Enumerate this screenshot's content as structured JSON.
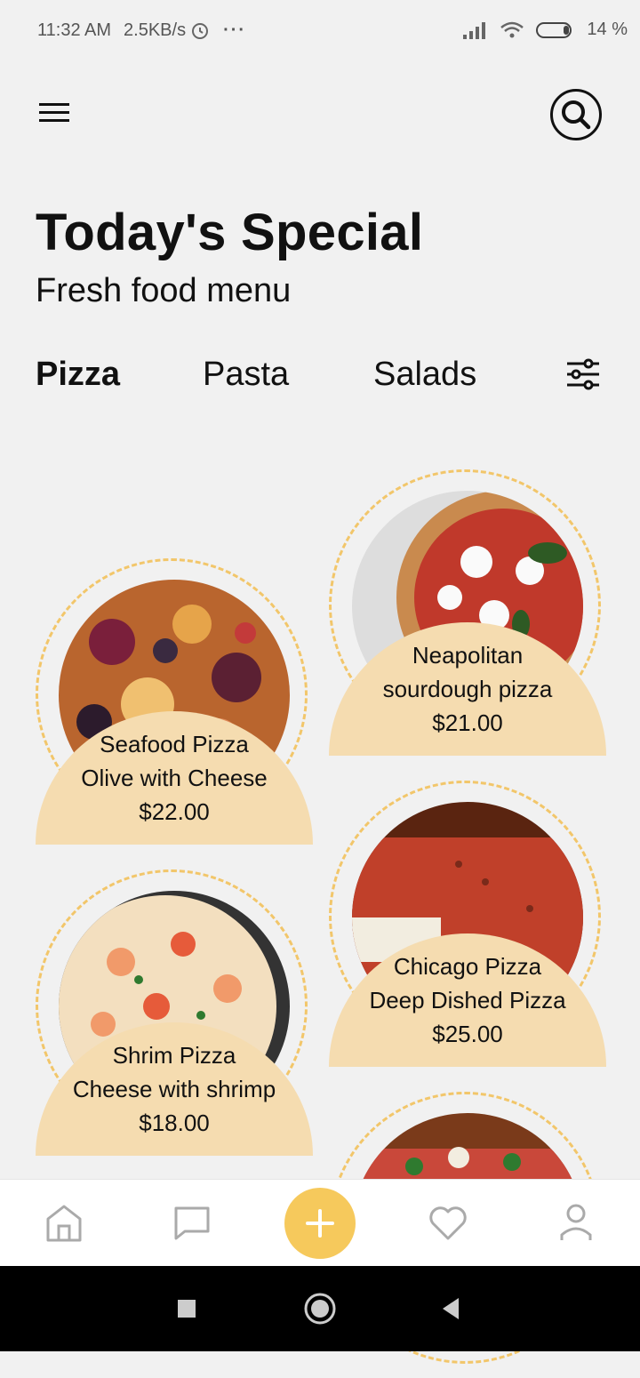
{
  "status": {
    "time": "11:32 AM",
    "speed": "2.5KB/s",
    "dots": "···",
    "battery": "14 %"
  },
  "header": {
    "title": "Today's Special",
    "subtitle": "Fresh food menu"
  },
  "tabs": [
    "Pizza",
    "Pasta",
    "Salads"
  ],
  "items": [
    {
      "line1": "Seafood Pizza",
      "line2": "Olive with Cheese",
      "price": "$22.00"
    },
    {
      "line1": "Neapolitan",
      "line2": "sourdough pizza",
      "price": "$21.00"
    },
    {
      "line1": "Shrim Pizza",
      "line2": "Cheese with shrimp",
      "price": "$18.00"
    },
    {
      "line1": "Chicago Pizza",
      "line2": "Deep Dished Pizza",
      "price": "$25.00"
    }
  ],
  "colors": {
    "accent": "#f6c95c",
    "card": "#f5dcb0",
    "ring": "#f2c66a",
    "background": "#f1f1f1"
  },
  "icons": [
    "menu-icon",
    "search-icon",
    "filter-icon",
    "home-icon",
    "chat-icon",
    "plus-icon",
    "heart-icon",
    "user-icon"
  ]
}
